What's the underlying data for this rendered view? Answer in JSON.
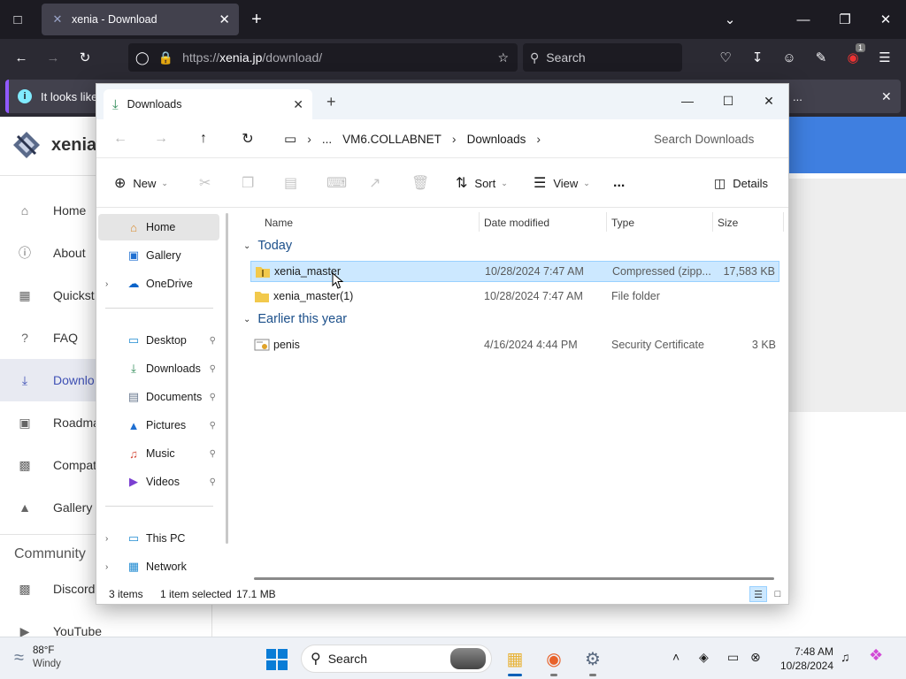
{
  "browser": {
    "tab_title": "xenia - Download",
    "url_scheme": "https://",
    "url_host": "xenia.jp",
    "url_path": "/download/",
    "search_placeholder": "Search",
    "extension_badge": "1",
    "notification_text": "It looks like",
    "notification_more": "..."
  },
  "site": {
    "logo_text": "xenia",
    "nav": [
      {
        "label": "Home",
        "icon": "home-icon"
      },
      {
        "label": "About",
        "icon": "info-icon"
      },
      {
        "label": "Quickst",
        "icon": "clipboard-icon"
      },
      {
        "label": "FAQ",
        "icon": "help-icon"
      },
      {
        "label": "Downlo",
        "icon": "download-icon"
      },
      {
        "label": "Roadma",
        "icon": "calendar-icon"
      },
      {
        "label": "Compat",
        "icon": "bar-chart-icon"
      },
      {
        "label": "Gallery",
        "icon": "image-icon"
      }
    ],
    "community_heading": "Community",
    "community": [
      {
        "label": "Discord",
        "icon": "chat-icon"
      },
      {
        "label": "YouTube",
        "icon": "video-icon"
      }
    ]
  },
  "explorer": {
    "tab_title": "Downloads",
    "breadcrumb": {
      "more": "...",
      "machine": "VM6.COLLABNET",
      "folder": "Downloads"
    },
    "search_placeholder": "Search Downloads",
    "commands": {
      "new": "New",
      "sort": "Sort",
      "view": "View",
      "more": "...",
      "details": "Details"
    },
    "sidebar": {
      "home": "Home",
      "gallery": "Gallery",
      "onedrive": "OneDrive",
      "desktop": "Desktop",
      "downloads": "Downloads",
      "documents": "Documents",
      "pictures": "Pictures",
      "music": "Music",
      "videos": "Videos",
      "this_pc": "This PC",
      "network": "Network"
    },
    "columns": {
      "name": "Name",
      "date": "Date modified",
      "type": "Type",
      "size": "Size"
    },
    "groups": {
      "today": "Today",
      "earlier": "Earlier this year"
    },
    "files": [
      {
        "name": "xenia_master",
        "date": "10/28/2024 7:47 AM",
        "type": "Compressed (zipp...",
        "size": "17,583 KB"
      },
      {
        "name": "xenia_master(1)",
        "date": "10/28/2024 7:47 AM",
        "type": "File folder",
        "size": ""
      },
      {
        "name": "penis",
        "date": "4/16/2024 4:44 PM",
        "type": "Security Certificate",
        "size": "3 KB"
      }
    ],
    "status": {
      "items": "3 items",
      "selected": "1 item selected",
      "size": "17.1 MB"
    }
  },
  "taskbar": {
    "temp": "88°F",
    "condition": "Windy",
    "search_label": "Search",
    "time": "7:48 AM",
    "date": "10/28/2024"
  },
  "colors": {
    "accent": "#005fb8",
    "selection": "#cce8ff",
    "browser_dark": "#1c1b22",
    "site_header": "#3f7fe0"
  }
}
